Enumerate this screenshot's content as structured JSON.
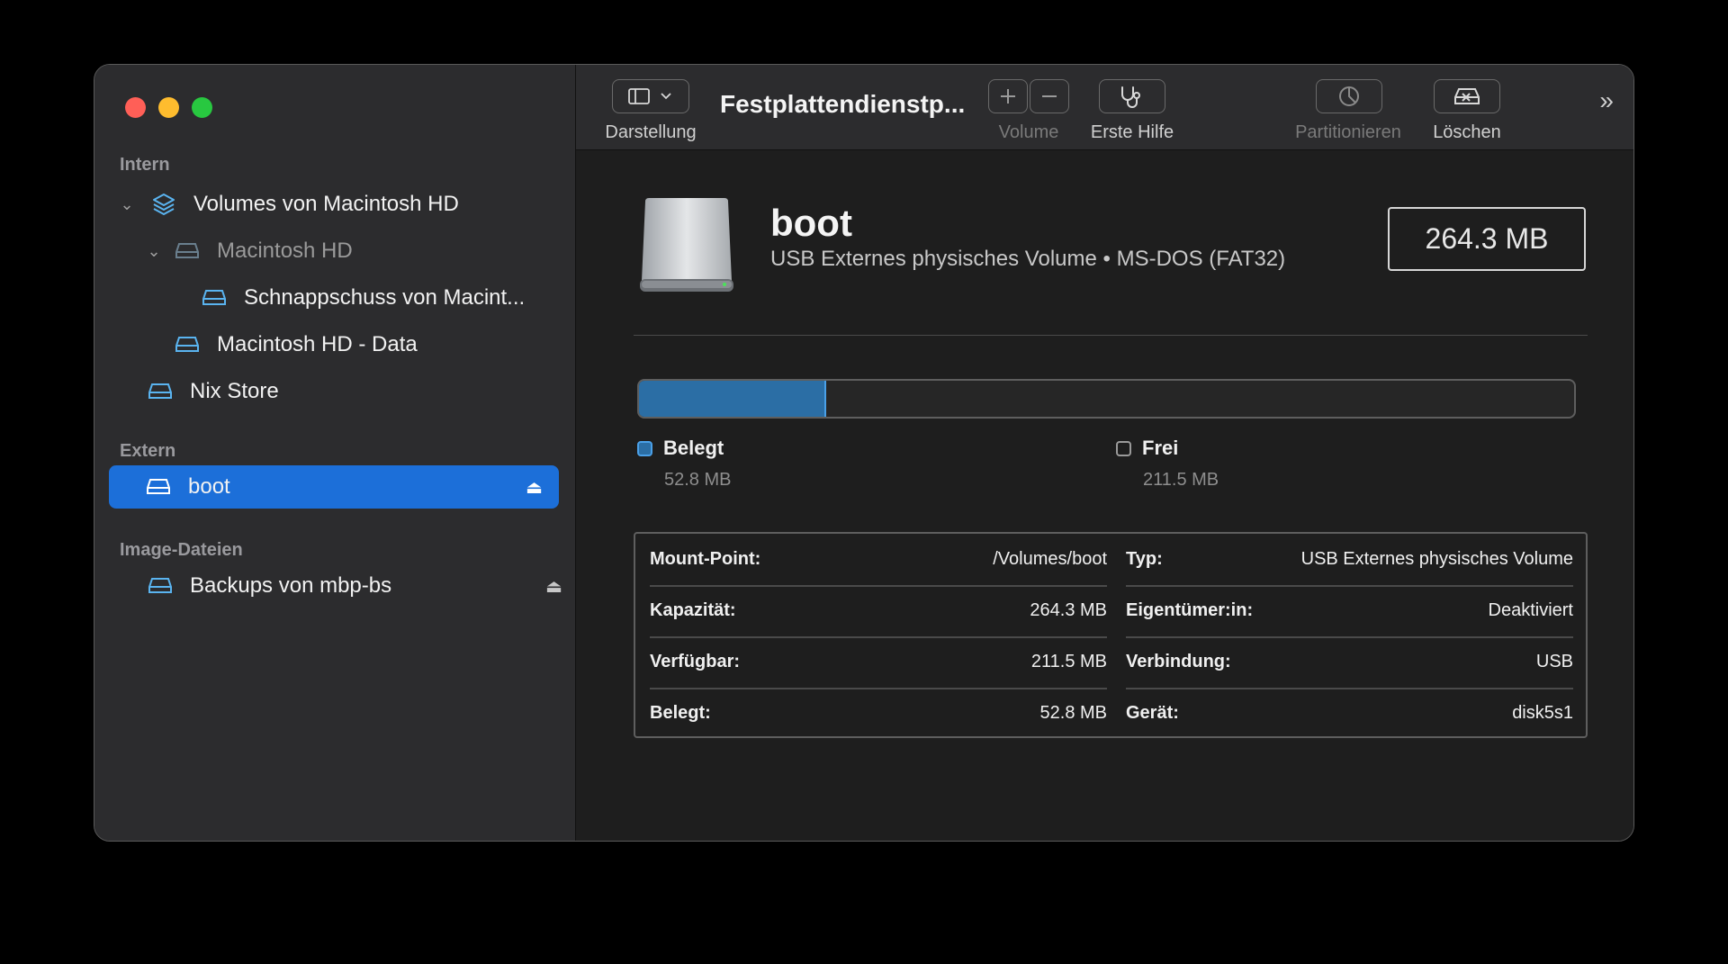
{
  "sidebar": {
    "sections": {
      "intern": "Intern",
      "extern": "Extern",
      "images": "Image-Dateien"
    },
    "items": [
      {
        "label": "Volumes von Macintosh HD"
      },
      {
        "label": "Macintosh HD"
      },
      {
        "label": "Schnappschuss von Macint..."
      },
      {
        "label": "Macintosh HD - Data"
      },
      {
        "label": "Nix Store"
      },
      {
        "label": "boot"
      },
      {
        "label": "Backups von mbp-bs"
      }
    ]
  },
  "toolbar": {
    "view_label": "Darstellung",
    "title": "Festplattendienstp...",
    "volume_label": "Volume",
    "firstaid_label": "Erste Hilfe",
    "partition_label": "Partitionieren",
    "erase_label": "Löschen"
  },
  "volume": {
    "name": "boot",
    "subtitle": "USB Externes physisches Volume • MS-DOS (FAT32)",
    "size": "264.3 MB"
  },
  "usage": {
    "used_fraction": 0.2,
    "used_label": "Belegt",
    "used_value": "52.8 MB",
    "free_label": "Frei",
    "free_value": "211.5 MB",
    "used_color": "#2b6ea5"
  },
  "info": {
    "left": [
      {
        "key": "Mount-Point:",
        "value": "/Volumes/boot"
      },
      {
        "key": "Kapazität:",
        "value": "264.3 MB"
      },
      {
        "key": "Verfügbar:",
        "value": "211.5 MB"
      },
      {
        "key": "Belegt:",
        "value": "52.8 MB"
      }
    ],
    "right": [
      {
        "key": "Typ:",
        "value": "USB Externes physisches Volume"
      },
      {
        "key": "Eigentümer:in:",
        "value": "Deaktiviert"
      },
      {
        "key": "Verbindung:",
        "value": "USB"
      },
      {
        "key": "Gerät:",
        "value": "disk5s1"
      }
    ]
  }
}
